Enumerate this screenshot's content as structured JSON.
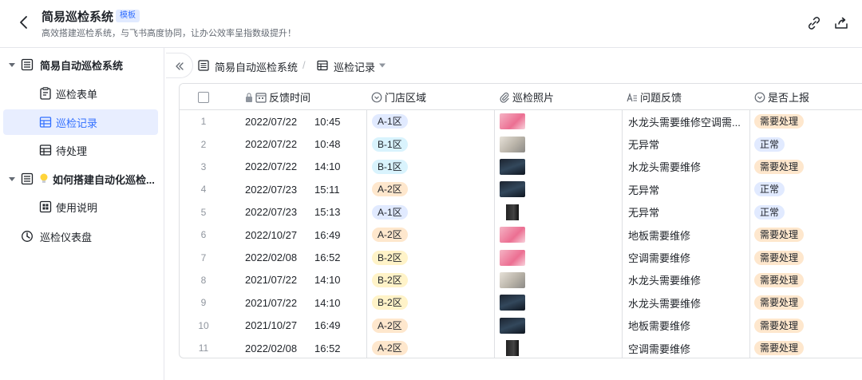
{
  "header": {
    "title": "简易巡检系统",
    "badge": "模板",
    "subtitle": "高效搭建巡检系统，与飞书高度协同，让办公效率呈指数级提升！"
  },
  "sidebar": {
    "items": [
      {
        "label": "简易自动巡检系统",
        "icon": "table-doc-icon"
      },
      {
        "label": "巡检表单",
        "icon": "form-icon"
      },
      {
        "label": "巡检记录",
        "icon": "grid-table-icon"
      },
      {
        "label": "待处理",
        "icon": "grid-table-icon"
      },
      {
        "label": "如何搭建自动化巡检...",
        "icon": "lightbulb-icon"
      },
      {
        "label": "使用说明",
        "icon": "doc-grid-icon"
      },
      {
        "label": "巡检仪表盘",
        "icon": "dashboard-icon"
      }
    ]
  },
  "breadcrumb": {
    "base": "简易自动巡检系统",
    "sep": "/",
    "view": "巡检记录"
  },
  "table": {
    "columns": [
      "反馈时间",
      "门店区域",
      "巡检照片",
      "问题反馈",
      "是否上报"
    ],
    "rows": [
      {
        "n": "1",
        "date": "2022/07/22",
        "time": "10:45",
        "area": "A-1区",
        "photo": "pink",
        "issue": "水龙头需要维修空调需...",
        "report": "需要处理"
      },
      {
        "n": "2",
        "date": "2022/07/22",
        "time": "10:48",
        "area": "B-1区",
        "photo": "gray",
        "issue": "无异常",
        "report": "正常"
      },
      {
        "n": "3",
        "date": "2022/07/22",
        "time": "14:10",
        "area": "B-1区",
        "photo": "dark",
        "issue": "水龙头需要维修",
        "report": "需要处理"
      },
      {
        "n": "4",
        "date": "2022/07/23",
        "time": "15:11",
        "area": "A-2区",
        "photo": "dark",
        "issue": "无异常",
        "report": "正常"
      },
      {
        "n": "5",
        "date": "2022/07/23",
        "time": "15:13",
        "area": "A-1区",
        "photo": "phone",
        "issue": "无异常",
        "report": "正常"
      },
      {
        "n": "6",
        "date": "2022/10/27",
        "time": "16:49",
        "area": "A-2区",
        "photo": "pink",
        "issue": "地板需要维修",
        "report": "需要处理"
      },
      {
        "n": "7",
        "date": "2022/02/08",
        "time": "16:52",
        "area": "B-2区",
        "photo": "pink",
        "issue": "空调需要维修",
        "report": "需要处理"
      },
      {
        "n": "8",
        "date": "2021/07/22",
        "time": "14:10",
        "area": "B-2区",
        "photo": "gray",
        "issue": "水龙头需要维修",
        "report": "需要处理"
      },
      {
        "n": "9",
        "date": "2021/07/22",
        "time": "14:10",
        "area": "B-2区",
        "photo": "dark",
        "issue": "水龙头需要维修",
        "report": "需要处理"
      },
      {
        "n": "10",
        "date": "2021/10/27",
        "time": "16:49",
        "area": "A-2区",
        "photo": "dark",
        "issue": "地板需要维修",
        "report": "需要处理"
      },
      {
        "n": "11",
        "date": "2022/02/08",
        "time": "16:52",
        "area": "A-2区",
        "photo": "phone",
        "issue": "空调需要维修",
        "report": "需要处理"
      }
    ]
  },
  "colors": {
    "accent": "#3370ff",
    "tag_A1": "#e1eaff",
    "tag_B1": "#d9f3fd",
    "tag_A2": "#fee7cd",
    "tag_B2": "#fff3c8",
    "tag_normal": "#e1eaff",
    "tag_process": "#fee7cd"
  }
}
